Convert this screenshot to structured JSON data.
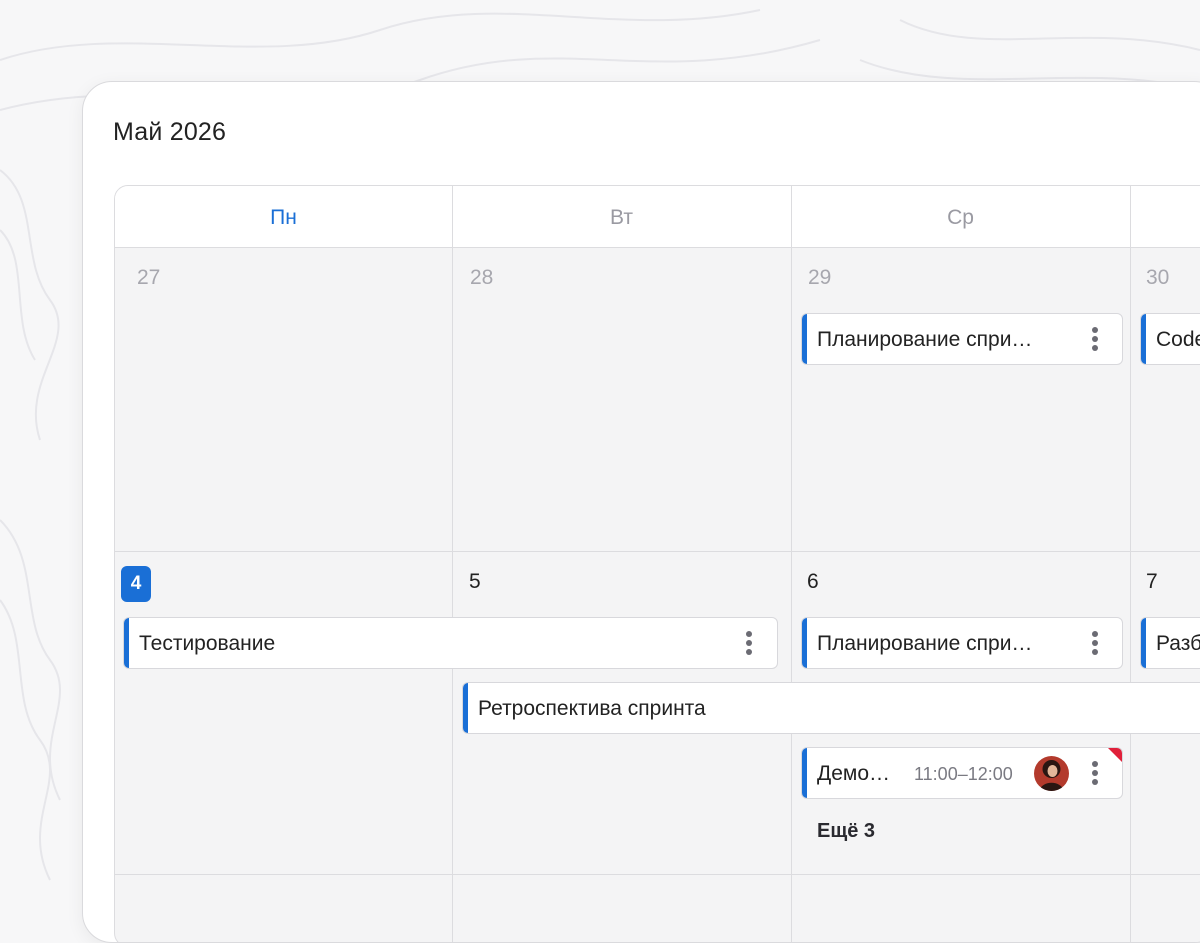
{
  "calendar": {
    "month_title": "Май 2026",
    "weekdays": [
      {
        "label": "Пн",
        "active": true
      },
      {
        "label": "Вт",
        "active": false
      },
      {
        "label": "Ср",
        "active": false
      }
    ],
    "week1": {
      "days": [
        "27",
        "28",
        "29",
        "30"
      ],
      "events": {
        "wed_title": "Планирование спри…",
        "thu_title": "Code"
      }
    },
    "week2": {
      "days": [
        "4",
        "5",
        "6",
        "7"
      ],
      "today": "4",
      "events": {
        "testing_title": "Тестирование",
        "wed_plan_title": "Планирование спри…",
        "thu_title": "Разб",
        "retro_title": "Ретроспектива спринта",
        "demo_title": "Демо…",
        "demo_time": "11:00–12:00"
      },
      "more_label": "Ещё 3"
    }
  },
  "colors": {
    "accent": "#1a6fd6",
    "flag": "#e0203a"
  },
  "icons": {
    "event_menu": "kebab-icon",
    "attendee": "avatar"
  }
}
